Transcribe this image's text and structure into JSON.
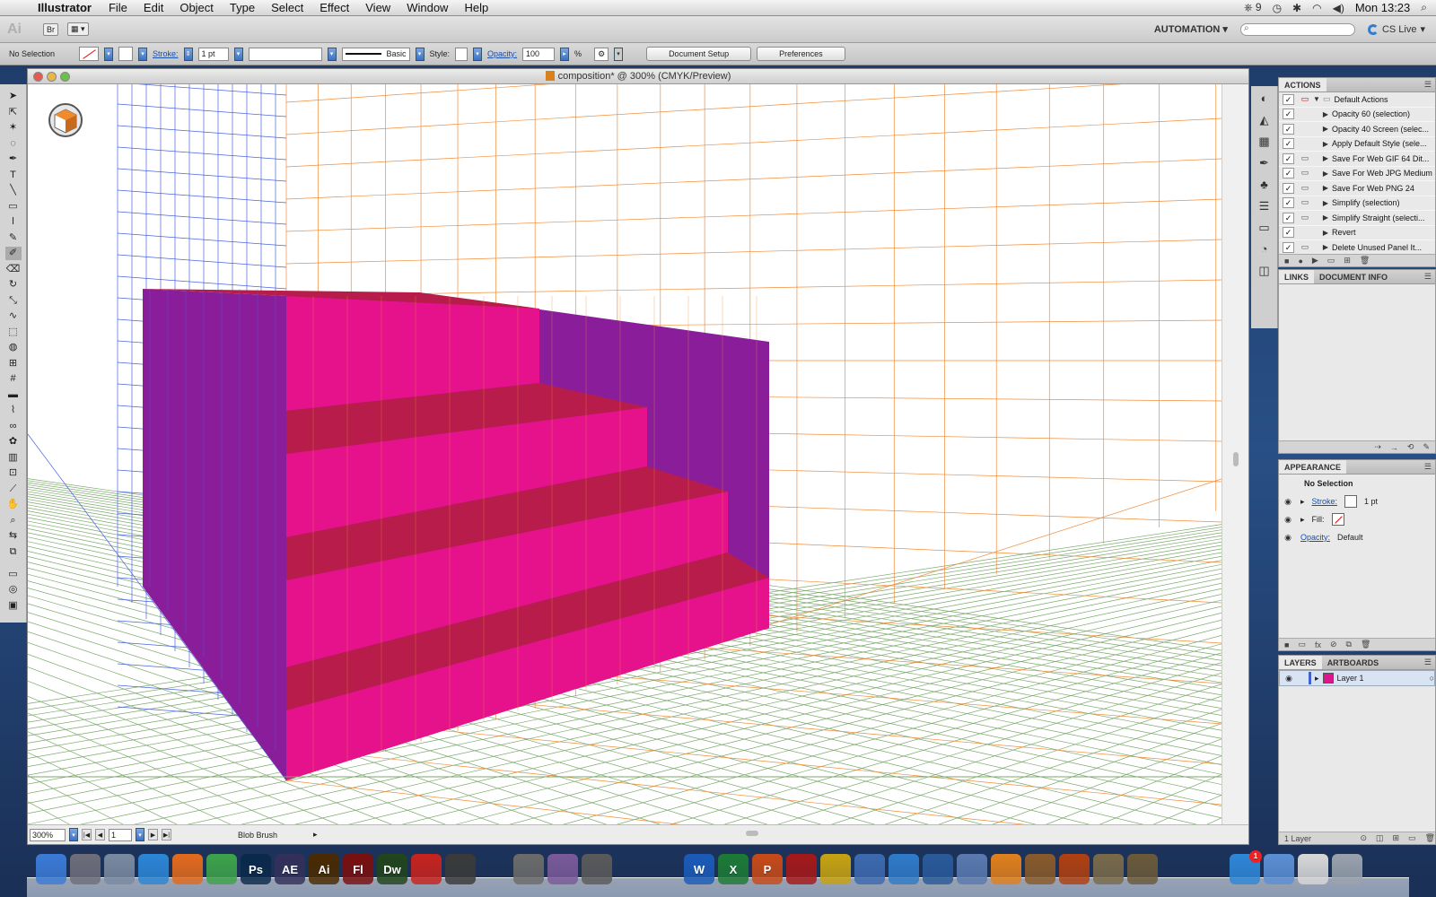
{
  "menubar": {
    "app_name": "Illustrator",
    "menus": [
      "File",
      "Edit",
      "Object",
      "Type",
      "Select",
      "Effect",
      "View",
      "Window",
      "Help"
    ],
    "status": {
      "adobe_count": "9",
      "clock": "Mon 13:23"
    }
  },
  "appbar": {
    "logo": "Ai",
    "bridge": "Br",
    "workspace": "AUTOMATION",
    "search_placeholder": "",
    "cs_live": "CS Live"
  },
  "control_bar": {
    "selection": "No Selection",
    "stroke_label": "Stroke:",
    "stroke_weight": "1 pt",
    "brush_style": "Basic",
    "style_label": "Style:",
    "opacity_label": "Opacity:",
    "opacity_value": "100",
    "opacity_unit": "%",
    "document_setup": "Document Setup",
    "preferences": "Preferences"
  },
  "document": {
    "title": "composition* @ 300% (CMYK/Preview)",
    "zoom": "300%",
    "artboard": "1",
    "status_tool": "Blob Brush"
  },
  "tools": [
    "select",
    "direct-select",
    "magic-wand",
    "lasso",
    "pen",
    "type",
    "line",
    "rectangle",
    "paintbrush",
    "pencil",
    "blob-brush",
    "eraser",
    "rotate",
    "scale",
    "warp",
    "free-transform",
    "shape-builder",
    "perspective-grid",
    "mesh",
    "gradient",
    "eyedropper",
    "blend",
    "symbol-sprayer",
    "column-graph",
    "artboard",
    "slice",
    "hand",
    "zoom"
  ],
  "actions_panel": {
    "tab": "ACTIONS",
    "set_name": "Default Actions",
    "items": [
      {
        "label": "Opacity 60 (selection)",
        "dialog": "blank"
      },
      {
        "label": "Opacity 40 Screen (selec...",
        "dialog": "blank"
      },
      {
        "label": "Apply Default Style (sele...",
        "dialog": "blank"
      },
      {
        "label": "Save For Web GIF 64 Dit...",
        "dialog": "off"
      },
      {
        "label": "Save For Web JPG Medium",
        "dialog": "off"
      },
      {
        "label": "Save For Web PNG 24",
        "dialog": "off"
      },
      {
        "label": "Simplify (selection)",
        "dialog": "off"
      },
      {
        "label": "Simplify Straight (selecti...",
        "dialog": "off"
      },
      {
        "label": "Revert",
        "dialog": "blank"
      },
      {
        "label": "Delete Unused Panel It...",
        "dialog": "off"
      }
    ]
  },
  "links_panel": {
    "tabs": [
      "LINKS",
      "DOCUMENT INFO"
    ]
  },
  "appearance_panel": {
    "tab": "APPEARANCE",
    "header": "No Selection",
    "stroke_label": "Stroke:",
    "stroke_value": "1 pt",
    "fill_label": "Fill:",
    "opacity_label": "Opacity:",
    "opacity_value": "Default"
  },
  "layers_panel": {
    "tabs": [
      "LAYERS",
      "ARTBOARDS"
    ],
    "layer_name": "Layer 1",
    "footer": "1 Layer"
  },
  "dock": {
    "apps": [
      {
        "name": "finder",
        "label": "",
        "color": "#3b7bd6"
      },
      {
        "name": "launchpad",
        "label": "",
        "color": "#6e6e7a"
      },
      {
        "name": "preview",
        "label": "",
        "color": "#7a8aa0"
      },
      {
        "name": "safari",
        "label": "",
        "color": "#2c86d6"
      },
      {
        "name": "firefox",
        "label": "",
        "color": "#e36a1c"
      },
      {
        "name": "chrome",
        "label": "",
        "color": "#3da34a"
      },
      {
        "name": "photoshop",
        "label": "Ps",
        "color": "#0a2a4a"
      },
      {
        "name": "after-effects",
        "label": "AE",
        "color": "#33305a"
      },
      {
        "name": "illustrator",
        "label": "Ai",
        "color": "#4a2a00"
      },
      {
        "name": "flash",
        "label": "Fl",
        "color": "#7a0f0f"
      },
      {
        "name": "dreamweaver",
        "label": "Dw",
        "color": "#21451c"
      },
      {
        "name": "acrobat",
        "label": "",
        "color": "#c8231e"
      },
      {
        "name": "imovie",
        "label": "",
        "color": "#3a3a3a"
      },
      {
        "name": "final-cut",
        "label": "",
        "color": "#444"
      },
      {
        "name": "dvd-player",
        "label": "",
        "color": "#6b6b6b"
      },
      {
        "name": "color-sync",
        "label": "",
        "color": "#7a5a9a"
      },
      {
        "name": "dashboard",
        "label": "",
        "color": "#5a5a5a"
      },
      {
        "name": "clapper",
        "label": "",
        "color": "#333"
      },
      {
        "name": "cinema",
        "label": "",
        "color": "#555"
      },
      {
        "name": "word",
        "label": "W",
        "color": "#1b5bb8"
      },
      {
        "name": "excel",
        "label": "X",
        "color": "#1d7a36"
      },
      {
        "name": "powerpoint",
        "label": "P",
        "color": "#c84a18"
      },
      {
        "name": "app-x",
        "label": "",
        "color": "#a61818"
      },
      {
        "name": "utility",
        "label": "",
        "color": "#c8a310"
      },
      {
        "name": "network",
        "label": "",
        "color": "#3d6ab0"
      },
      {
        "name": "itunes",
        "label": "",
        "color": "#2f7bc8"
      },
      {
        "name": "quicktime",
        "label": "",
        "color": "#2a5a9a"
      },
      {
        "name": "system-info",
        "label": "",
        "color": "#5a7ab0"
      },
      {
        "name": "vlc",
        "label": "",
        "color": "#e2801c"
      },
      {
        "name": "garageband",
        "label": "",
        "color": "#8a5a2a"
      },
      {
        "name": "torrent",
        "label": "",
        "color": "#b04010"
      },
      {
        "name": "photos",
        "label": "",
        "color": "#7a6a4a"
      },
      {
        "name": "iphoto",
        "label": "",
        "color": "#6a5a3a"
      },
      {
        "name": "screen-capture",
        "label": "",
        "color": "#445"
      },
      {
        "name": "gear-settings",
        "label": "",
        "color": "#777"
      },
      {
        "name": "app-store",
        "label": "",
        "color": "#2e87d8",
        "badge": "1"
      },
      {
        "name": "folder",
        "label": "",
        "color": "#5b8fd4"
      },
      {
        "name": "documents",
        "label": "",
        "color": "#d8d8d8"
      },
      {
        "name": "trash",
        "label": "",
        "color": "#9aa3ad"
      }
    ]
  },
  "colors": {
    "magenta_face": "#e5128c",
    "step_top": "#b71c4a",
    "side_purple": "#8a1e9a",
    "grid_left": "#4a64e0",
    "grid_right": "#f18c3a",
    "grid_floor": "#7aa86a"
  }
}
